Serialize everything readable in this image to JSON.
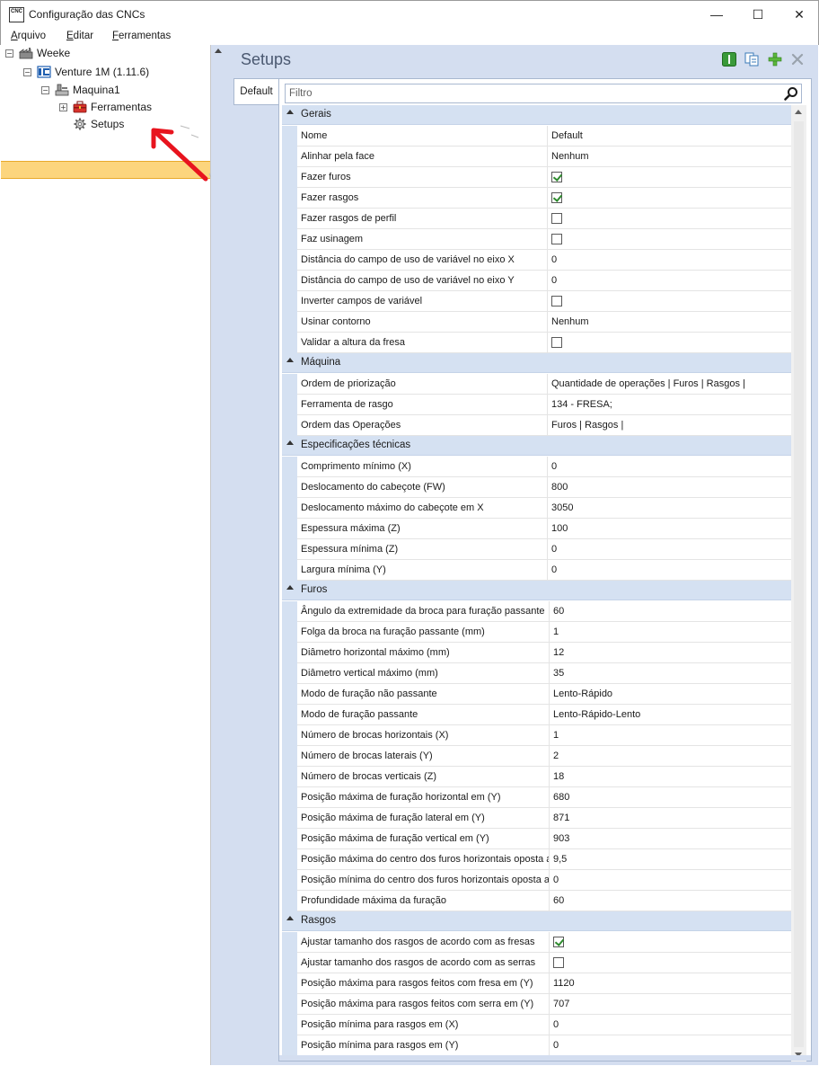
{
  "window": {
    "title": "Configuração das CNCs",
    "icon_text": "CNC",
    "minimize_label": "—",
    "maximize_label": "☐",
    "close_label": "✕"
  },
  "menu": [
    {
      "label": "Arquivo",
      "accel": "A",
      "rest": "rquivo"
    },
    {
      "label": "Editar",
      "accel": "E",
      "rest": "ditar"
    },
    {
      "label": "Ferramentas",
      "accel": "F",
      "rest": "erramentas"
    }
  ],
  "tree": {
    "weeke": "Weeke",
    "venture": "Venture 1M (1.11.6)",
    "maquina": "Maquina1",
    "ferramentas": "Ferramentas",
    "setups": "Setups"
  },
  "panel": {
    "title": "Setups",
    "tab": "Default",
    "filter_placeholder": "Filtro"
  },
  "categories": [
    {
      "name": "Gerais",
      "props": [
        {
          "name": "Nome",
          "value": "Default",
          "type": "text"
        },
        {
          "name": "Alinhar pela face",
          "value": "Nenhum",
          "type": "text"
        },
        {
          "name": "Fazer furos",
          "value": true,
          "type": "checkbox"
        },
        {
          "name": "Fazer rasgos",
          "value": true,
          "type": "checkbox"
        },
        {
          "name": "Fazer rasgos de perfil",
          "value": false,
          "type": "checkbox"
        },
        {
          "name": "Faz usinagem",
          "value": false,
          "type": "checkbox"
        },
        {
          "name": "Distância do campo de uso de variável no eixo X",
          "value": "0",
          "type": "text"
        },
        {
          "name": "Distância do campo de uso de variável no eixo Y",
          "value": "0",
          "type": "text"
        },
        {
          "name": "Inverter campos de variável",
          "value": false,
          "type": "checkbox"
        },
        {
          "name": "Usinar contorno",
          "value": "Nenhum",
          "type": "text"
        },
        {
          "name": "Validar a altura da fresa",
          "value": false,
          "type": "checkbox"
        }
      ]
    },
    {
      "name": "Máquina",
      "props": [
        {
          "name": "Ordem de priorização",
          "value": "Quantidade de operações | Furos | Rasgos |",
          "type": "text"
        },
        {
          "name": "Ferramenta de rasgo",
          "value": "134 - FRESA;",
          "type": "text"
        },
        {
          "name": "Ordem das Operações",
          "value": "Furos | Rasgos |",
          "type": "text"
        }
      ]
    },
    {
      "name": "Especificações técnicas",
      "props": [
        {
          "name": "Comprimento mínimo (X)",
          "value": "0",
          "type": "text"
        },
        {
          "name": "Deslocamento do cabeçote (FW)",
          "value": "800",
          "type": "text"
        },
        {
          "name": "Deslocamento máximo do cabeçote em X",
          "value": "3050",
          "type": "text"
        },
        {
          "name": "Espessura máxima (Z)",
          "value": "100",
          "type": "text"
        },
        {
          "name": "Espessura mínima (Z)",
          "value": "0",
          "type": "text"
        },
        {
          "name": "Largura mínima (Y)",
          "value": "0",
          "type": "text"
        }
      ]
    },
    {
      "name": "Furos",
      "props": [
        {
          "name": "Ângulo da extremidade da broca para furação passante",
          "value": "60",
          "type": "text"
        },
        {
          "name": "Folga da broca na furação passante (mm)",
          "value": "1",
          "type": "text"
        },
        {
          "name": "Diâmetro horizontal máximo (mm)",
          "value": "12",
          "type": "text"
        },
        {
          "name": "Diâmetro vertical máximo (mm)",
          "value": "35",
          "type": "text"
        },
        {
          "name": "Modo de furação não passante",
          "value": "Lento-Rápido",
          "type": "text"
        },
        {
          "name": "Modo de furação passante",
          "value": "Lento-Rápido-Lento",
          "type": "text"
        },
        {
          "name": "Número de brocas horizontais (X)",
          "value": "1",
          "type": "text"
        },
        {
          "name": "Número de brocas laterais (Y)",
          "value": "2",
          "type": "text"
        },
        {
          "name": "Número de brocas verticais (Z)",
          "value": "18",
          "type": "text"
        },
        {
          "name": "Posição máxima de furação horizontal em (Y)",
          "value": "680",
          "type": "text"
        },
        {
          "name": "Posição máxima de furação lateral em (Y)",
          "value": "871",
          "type": "text"
        },
        {
          "name": "Posição máxima de furação vertical em (Y)",
          "value": "903",
          "type": "text"
        },
        {
          "name": "Posição máxima do centro dos furos horizontais oposta a",
          "value": "9,5",
          "type": "text"
        },
        {
          "name": "Posição mínima do centro dos furos horizontais oposta a",
          "value": "0",
          "type": "text"
        },
        {
          "name": "Profundidade máxima da furação",
          "value": "60",
          "type": "text"
        }
      ]
    },
    {
      "name": "Rasgos",
      "props": [
        {
          "name": "Ajustar tamanho dos rasgos de acordo com as fresas",
          "value": true,
          "type": "checkbox"
        },
        {
          "name": "Ajustar tamanho dos rasgos de acordo com as serras",
          "value": false,
          "type": "checkbox"
        },
        {
          "name": "Posição máxima para rasgos feitos com fresa em (Y)",
          "value": "1120",
          "type": "text"
        },
        {
          "name": "Posição máxima para rasgos feitos com serra em (Y)",
          "value": "707",
          "type": "text"
        },
        {
          "name": "Posição mínima para rasgos em (X)",
          "value": "0",
          "type": "text"
        },
        {
          "name": "Posição mínima para rasgos em (Y)",
          "value": "0",
          "type": "text"
        }
      ]
    }
  ],
  "colors": {
    "selection": "#fcd57d",
    "panel_bg": "#d4def0",
    "category_bg": "#d5e1f2",
    "accent_red": "#e8141e"
  }
}
